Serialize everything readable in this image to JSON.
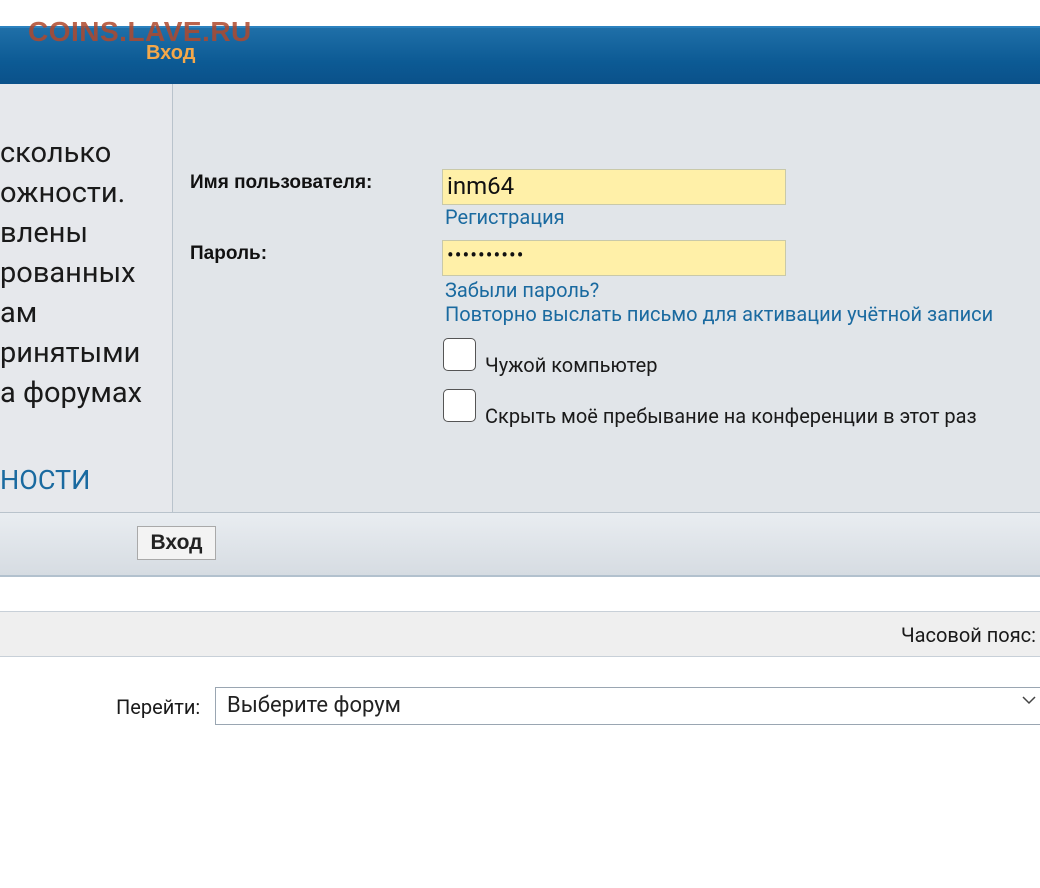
{
  "header": {
    "watermark": "COINS.LAVE.RU",
    "title": "Вход"
  },
  "left_info": {
    "lines": [
      "сколько",
      "ожности.",
      "влены",
      "рованных",
      "ам",
      "ринятыми",
      "а форумах"
    ],
    "link": "НОСТИ"
  },
  "form": {
    "username_label": "Имя пользователя:",
    "username_value": "inm64",
    "register_link": "Регистрация",
    "password_label": "Пароль:",
    "password_mask": "••••••••••",
    "forgot_link": "Забыли пароль?",
    "resend_link": "Повторно выслать письмо для активации учётной записи",
    "checkbox_public": "Чужой компьютер",
    "checkbox_hide": "Скрыть моё пребывание на конференции в этот раз"
  },
  "actions": {
    "login_button": "Вход"
  },
  "footer": {
    "timezone_label": "Часовой пояс:",
    "goto_label": "Перейти:",
    "forum_select": "Выберите форум"
  },
  "colors": {
    "header": "#0c5a94",
    "input_fill": "#fff0a8",
    "link": "#1a6aa0",
    "title": "#f4a84a"
  }
}
